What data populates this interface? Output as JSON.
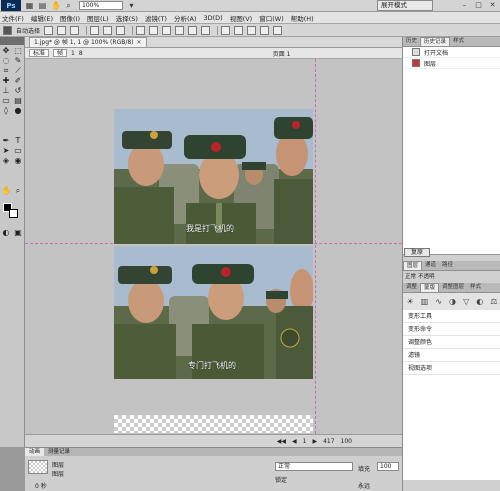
{
  "app": {
    "logo": "Ps",
    "zoom": "100%",
    "workspace": "展开模式"
  },
  "menu": [
    "文件(F)",
    "编辑(E)",
    "图像(I)",
    "图层(L)",
    "选择(S)",
    "滤镜(T)",
    "分析(A)",
    "3D(D)",
    "视图(V)",
    "窗口(W)",
    "帮助(H)"
  ],
  "options": {
    "auto_select": "自动选择"
  },
  "document": {
    "tab_label": "1.jpg* @ 帧 1, 1 @ 100% (RGB/8)",
    "view_std": "标准",
    "view_frames": "帧",
    "view_frames_count": "1",
    "view_layers_count": "8",
    "layer_comp": "页面 1"
  },
  "frames": {
    "top_subtitle": "我是打飞机的",
    "bottom_subtitle": "专门打飞机的"
  },
  "statusbar": {
    "frame_count": "1",
    "frame_total": "417",
    "zoom": "100"
  },
  "history_panel": {
    "tabs": [
      "历史",
      "历史记录",
      "样式"
    ],
    "items": [
      {
        "label": "打开文档"
      },
      {
        "label": "图层"
      }
    ],
    "reset_label": "复原"
  },
  "layers_panel": {
    "tabs": [
      "图层",
      "通道",
      "路径"
    ],
    "blend": "正常",
    "opacity_label": "不透明"
  },
  "adjust_panel": {
    "tabs": [
      "调整",
      "蒙版",
      "调整图层",
      "样式"
    ]
  },
  "actions_panel": {
    "items": [
      "变形工具",
      "变形命令",
      "调整颜色",
      "滤镜",
      "视图选项"
    ]
  },
  "bottom_panel": {
    "tabs": [
      "动画",
      "测量记录"
    ],
    "layer_title": "图层",
    "layer_sub": "图层",
    "blend_value": "正常",
    "lock_label": "锁定",
    "fill_label": "填充",
    "fill_value": "100",
    "loop_label": "永远",
    "frame_time": "0 秒"
  }
}
